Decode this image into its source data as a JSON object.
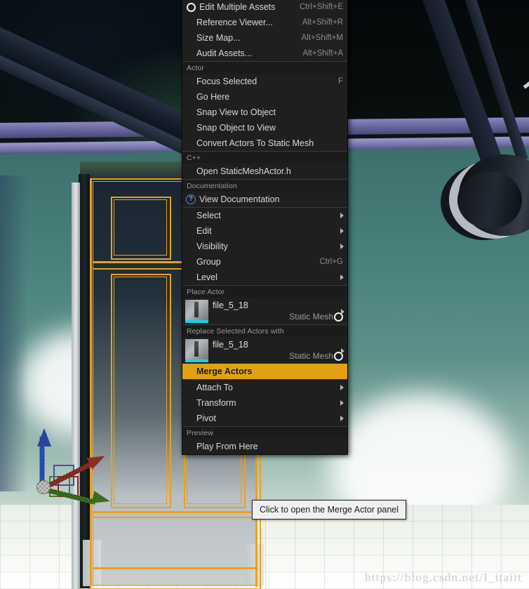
{
  "app": {
    "name": "Unreal Engine Level Editor Viewport",
    "watermark": "https://blog.csdn.net/I_itaiit"
  },
  "context_menu": {
    "groups": [
      {
        "header": null,
        "items": [
          {
            "label": "Edit Multiple Assets",
            "shortcut": "Ctrl+Shift+E",
            "icon": "ring-icon",
            "submenu": false,
            "highlight": false
          },
          {
            "label": "Reference Viewer...",
            "shortcut": "Alt+Shift+R",
            "icon": null,
            "submenu": false,
            "highlight": false
          },
          {
            "label": "Size Map...",
            "shortcut": "Alt+Shift+M",
            "icon": null,
            "submenu": false,
            "highlight": false
          },
          {
            "label": "Audit Assets...",
            "shortcut": "Alt+Shift+A",
            "icon": null,
            "submenu": false,
            "highlight": false
          }
        ]
      },
      {
        "header": "Actor",
        "items": [
          {
            "label": "Focus Selected",
            "shortcut": "F",
            "icon": null,
            "submenu": false,
            "highlight": false
          },
          {
            "label": "Go Here",
            "shortcut": "",
            "icon": null,
            "submenu": false,
            "highlight": false
          },
          {
            "label": "Snap View to Object",
            "shortcut": "",
            "icon": null,
            "submenu": false,
            "highlight": false
          },
          {
            "label": "Snap Object to View",
            "shortcut": "",
            "icon": null,
            "submenu": false,
            "highlight": false
          },
          {
            "label": "Convert Actors To Static Mesh",
            "shortcut": "",
            "icon": null,
            "submenu": false,
            "highlight": false
          }
        ]
      },
      {
        "header": "C++",
        "items": [
          {
            "label": "Open StaticMeshActor.h",
            "shortcut": "",
            "icon": null,
            "submenu": false,
            "highlight": false
          }
        ]
      },
      {
        "header": "Documentation",
        "items": [
          {
            "label": "View Documentation",
            "shortcut": "",
            "icon": "help-icon",
            "submenu": false,
            "highlight": false
          }
        ]
      },
      {
        "header": null,
        "items": [
          {
            "label": "Select",
            "shortcut": "",
            "icon": null,
            "submenu": true,
            "highlight": false
          },
          {
            "label": "Edit",
            "shortcut": "",
            "icon": null,
            "submenu": true,
            "highlight": false
          },
          {
            "label": "Visibility",
            "shortcut": "",
            "icon": null,
            "submenu": true,
            "highlight": false
          },
          {
            "label": "Group",
            "shortcut": "Ctrl+G",
            "icon": null,
            "submenu": false,
            "highlight": false
          },
          {
            "label": "Level",
            "shortcut": "",
            "icon": null,
            "submenu": true,
            "highlight": false
          }
        ]
      }
    ],
    "place_actor": {
      "header": "Place Actor",
      "asset_name": "file_5_18",
      "asset_type": "Static Mesh",
      "submenu": true
    },
    "replace_actor": {
      "header": "Replace Selected Actors with",
      "asset_name": "file_5_18",
      "asset_type": "Static Mesh",
      "submenu": true
    },
    "merge_actors": {
      "label": "Merge Actors",
      "highlight": true,
      "highlight_color": "#E0A213"
    },
    "transform_group": {
      "items": [
        {
          "label": "Attach To",
          "shortcut": "",
          "submenu": true
        },
        {
          "label": "Transform",
          "shortcut": "",
          "submenu": true
        },
        {
          "label": "Pivot",
          "shortcut": "",
          "submenu": true
        }
      ]
    },
    "preview_group": {
      "header": "Preview",
      "items": [
        {
          "label": "Play From Here",
          "shortcut": "",
          "submenu": false
        }
      ]
    }
  },
  "tooltip": {
    "text": "Click to open the Merge Actor panel"
  },
  "viewport": {
    "selected_actor_outline_color": "#E8A21A",
    "gizmo": {
      "x_axis_color": "#8a2f23",
      "y_axis_color": "#3d6b21",
      "z_axis_color": "#29459b"
    }
  }
}
